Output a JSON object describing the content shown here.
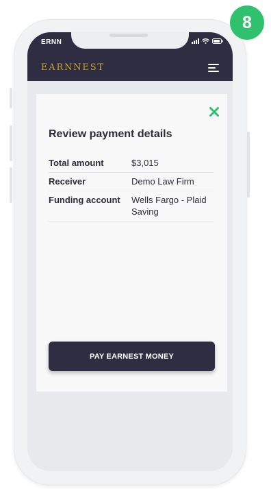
{
  "step_badge": "8",
  "status_bar": {
    "carrier": "ERNN",
    "icons": [
      "signal-icon",
      "wifi-icon",
      "battery-icon"
    ]
  },
  "app": {
    "logo": "EARNNEST",
    "menu_icon": "hamburger-menu-icon"
  },
  "card": {
    "close_icon": "close-icon",
    "title": "Review payment details",
    "details": [
      {
        "label": "Total amount",
        "value": "$3,015"
      },
      {
        "label": "Receiver",
        "value": "Demo Law Firm"
      },
      {
        "label": "Funding account",
        "value": "Wells Fargo - Plaid Saving"
      }
    ],
    "pay_button": "PAY EARNEST MONEY"
  },
  "colors": {
    "header": "#2e2d42",
    "logo_gold": "#c9a227",
    "accent_green": "#2fc16d",
    "card_bg": "#f8f8f9",
    "screen_bg": "#e8e9ec"
  }
}
